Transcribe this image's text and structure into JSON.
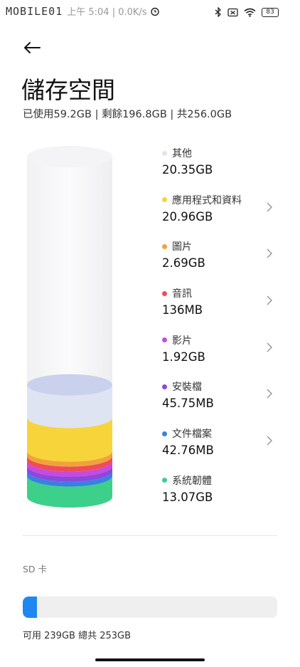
{
  "status_bar": {
    "watermark": "MOBILE01",
    "time": "上午 5:04 | 0.0K/s",
    "battery": "83",
    "icons": [
      "bluetooth-icon",
      "dnd-icon",
      "wifi-icon",
      "battery-icon"
    ]
  },
  "page": {
    "title": "儲存空間",
    "summary": "已使用59.2GB | 剩餘196.8GB | 共256.0GB"
  },
  "categories": [
    {
      "label": "其他",
      "value": "20.35GB",
      "color": "#dfe4f2",
      "chevron": false
    },
    {
      "label": "應用程式和資料",
      "value": "20.96GB",
      "color": "#f7d43a",
      "chevron": true
    },
    {
      "label": "圖片",
      "value": "2.69GB",
      "color": "#f2a23a",
      "chevron": true
    },
    {
      "label": "音訊",
      "value": "136MB",
      "color": "#ee4d58",
      "chevron": true
    },
    {
      "label": "影片",
      "value": "1.92GB",
      "color": "#c749e0",
      "chevron": true
    },
    {
      "label": "安裝檔",
      "value": "45.75MB",
      "color": "#8b48dc",
      "chevron": true
    },
    {
      "label": "文件檔案",
      "value": "42.76MB",
      "color": "#3a7fe3",
      "chevron": true
    },
    {
      "label": "系統韌體",
      "value": "13.07GB",
      "color": "#3dd08a",
      "chevron": false
    }
  ],
  "chart_data": {
    "type": "bar",
    "title": "",
    "total_gb": 256.0,
    "used_gb": 59.2,
    "free_gb": 196.8,
    "categories": [
      "其他",
      "應用程式和資料",
      "圖片",
      "音訊",
      "影片",
      "安裝檔",
      "文件檔案",
      "系統韌體"
    ],
    "values_gb": [
      20.35,
      20.96,
      2.69,
      0.136,
      1.92,
      0.04575,
      0.04276,
      13.07
    ]
  },
  "sd_card": {
    "label": "SD 卡",
    "usage_text": "可用 239GB  總共 253GB",
    "used_fraction": 0.055,
    "color": "#1e88f0"
  }
}
